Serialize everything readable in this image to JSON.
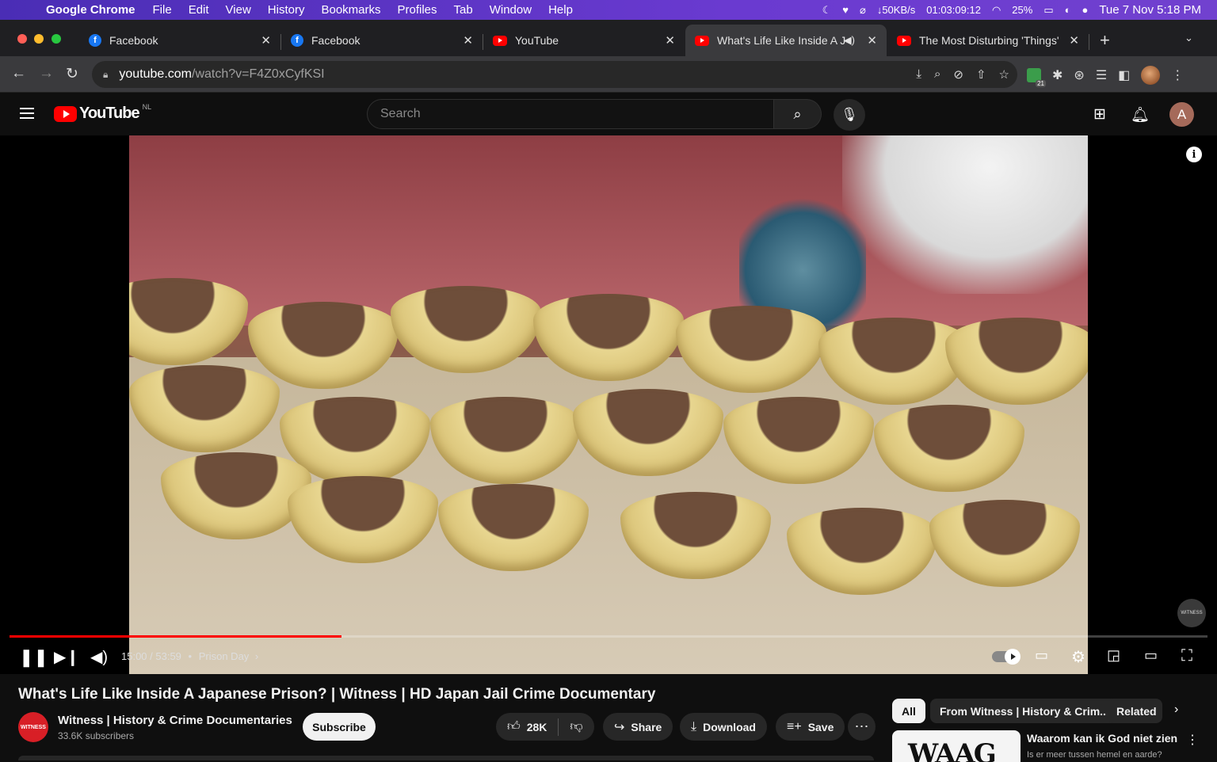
{
  "menubar": {
    "app_name": "Google Chrome",
    "items": [
      "File",
      "Edit",
      "View",
      "History",
      "Bookmarks",
      "Profiles",
      "Tab",
      "Window",
      "Help"
    ],
    "net_speed": "↓50KB/s",
    "battery_time": "01:03:09:12",
    "battery_pct": "25%",
    "clock": "Tue 7 Nov  5:18 PM"
  },
  "tabs": [
    {
      "title": "Facebook",
      "favicon": "facebook-icon"
    },
    {
      "title": "Facebook",
      "favicon": "facebook-icon"
    },
    {
      "title": "YouTube",
      "favicon": "youtube-icon"
    },
    {
      "title": "What's Life Like Inside A J",
      "favicon": "youtube-icon",
      "active": true
    },
    {
      "title": "The Most Disturbing 'Things'",
      "favicon": "youtube-icon"
    }
  ],
  "address": {
    "host": "youtube.com",
    "path": "/watch?v=F4Z0xCyfKSI"
  },
  "extension_badge": "21",
  "youtube": {
    "logo_text": "YouTube",
    "country": "NL",
    "search_placeholder": "Search",
    "avatar_letter": "A"
  },
  "player": {
    "time": "15:00 / 53:59",
    "chapter": "Prison Day",
    "progress_fraction": 0.277,
    "watermark": "WITNESS"
  },
  "video": {
    "title": "What's Life Like Inside A Japanese Prison? | Witness | HD Japan Jail Crime Documentary",
    "channel": "Witness | History & Crime Documentaries",
    "channel_avatar_text": "WITNESS",
    "subscribers": "33.6K subscribers",
    "subscribe_label": "Subscribe",
    "likes": "28K",
    "share_label": "Share",
    "download_label": "Download",
    "save_label": "Save"
  },
  "chips": [
    "All",
    "From Witness | History & Crim...",
    "Related"
  ],
  "recommendation": {
    "title": "Waarom kan ik God niet zien",
    "subtitle": "Is er meer tussen hemel en aarde?",
    "thumb_text": "WAAG"
  },
  "colors": {
    "accent_red": "#ff0000",
    "menubar": "#5b33c8",
    "page_bg": "#0f0f0f"
  }
}
